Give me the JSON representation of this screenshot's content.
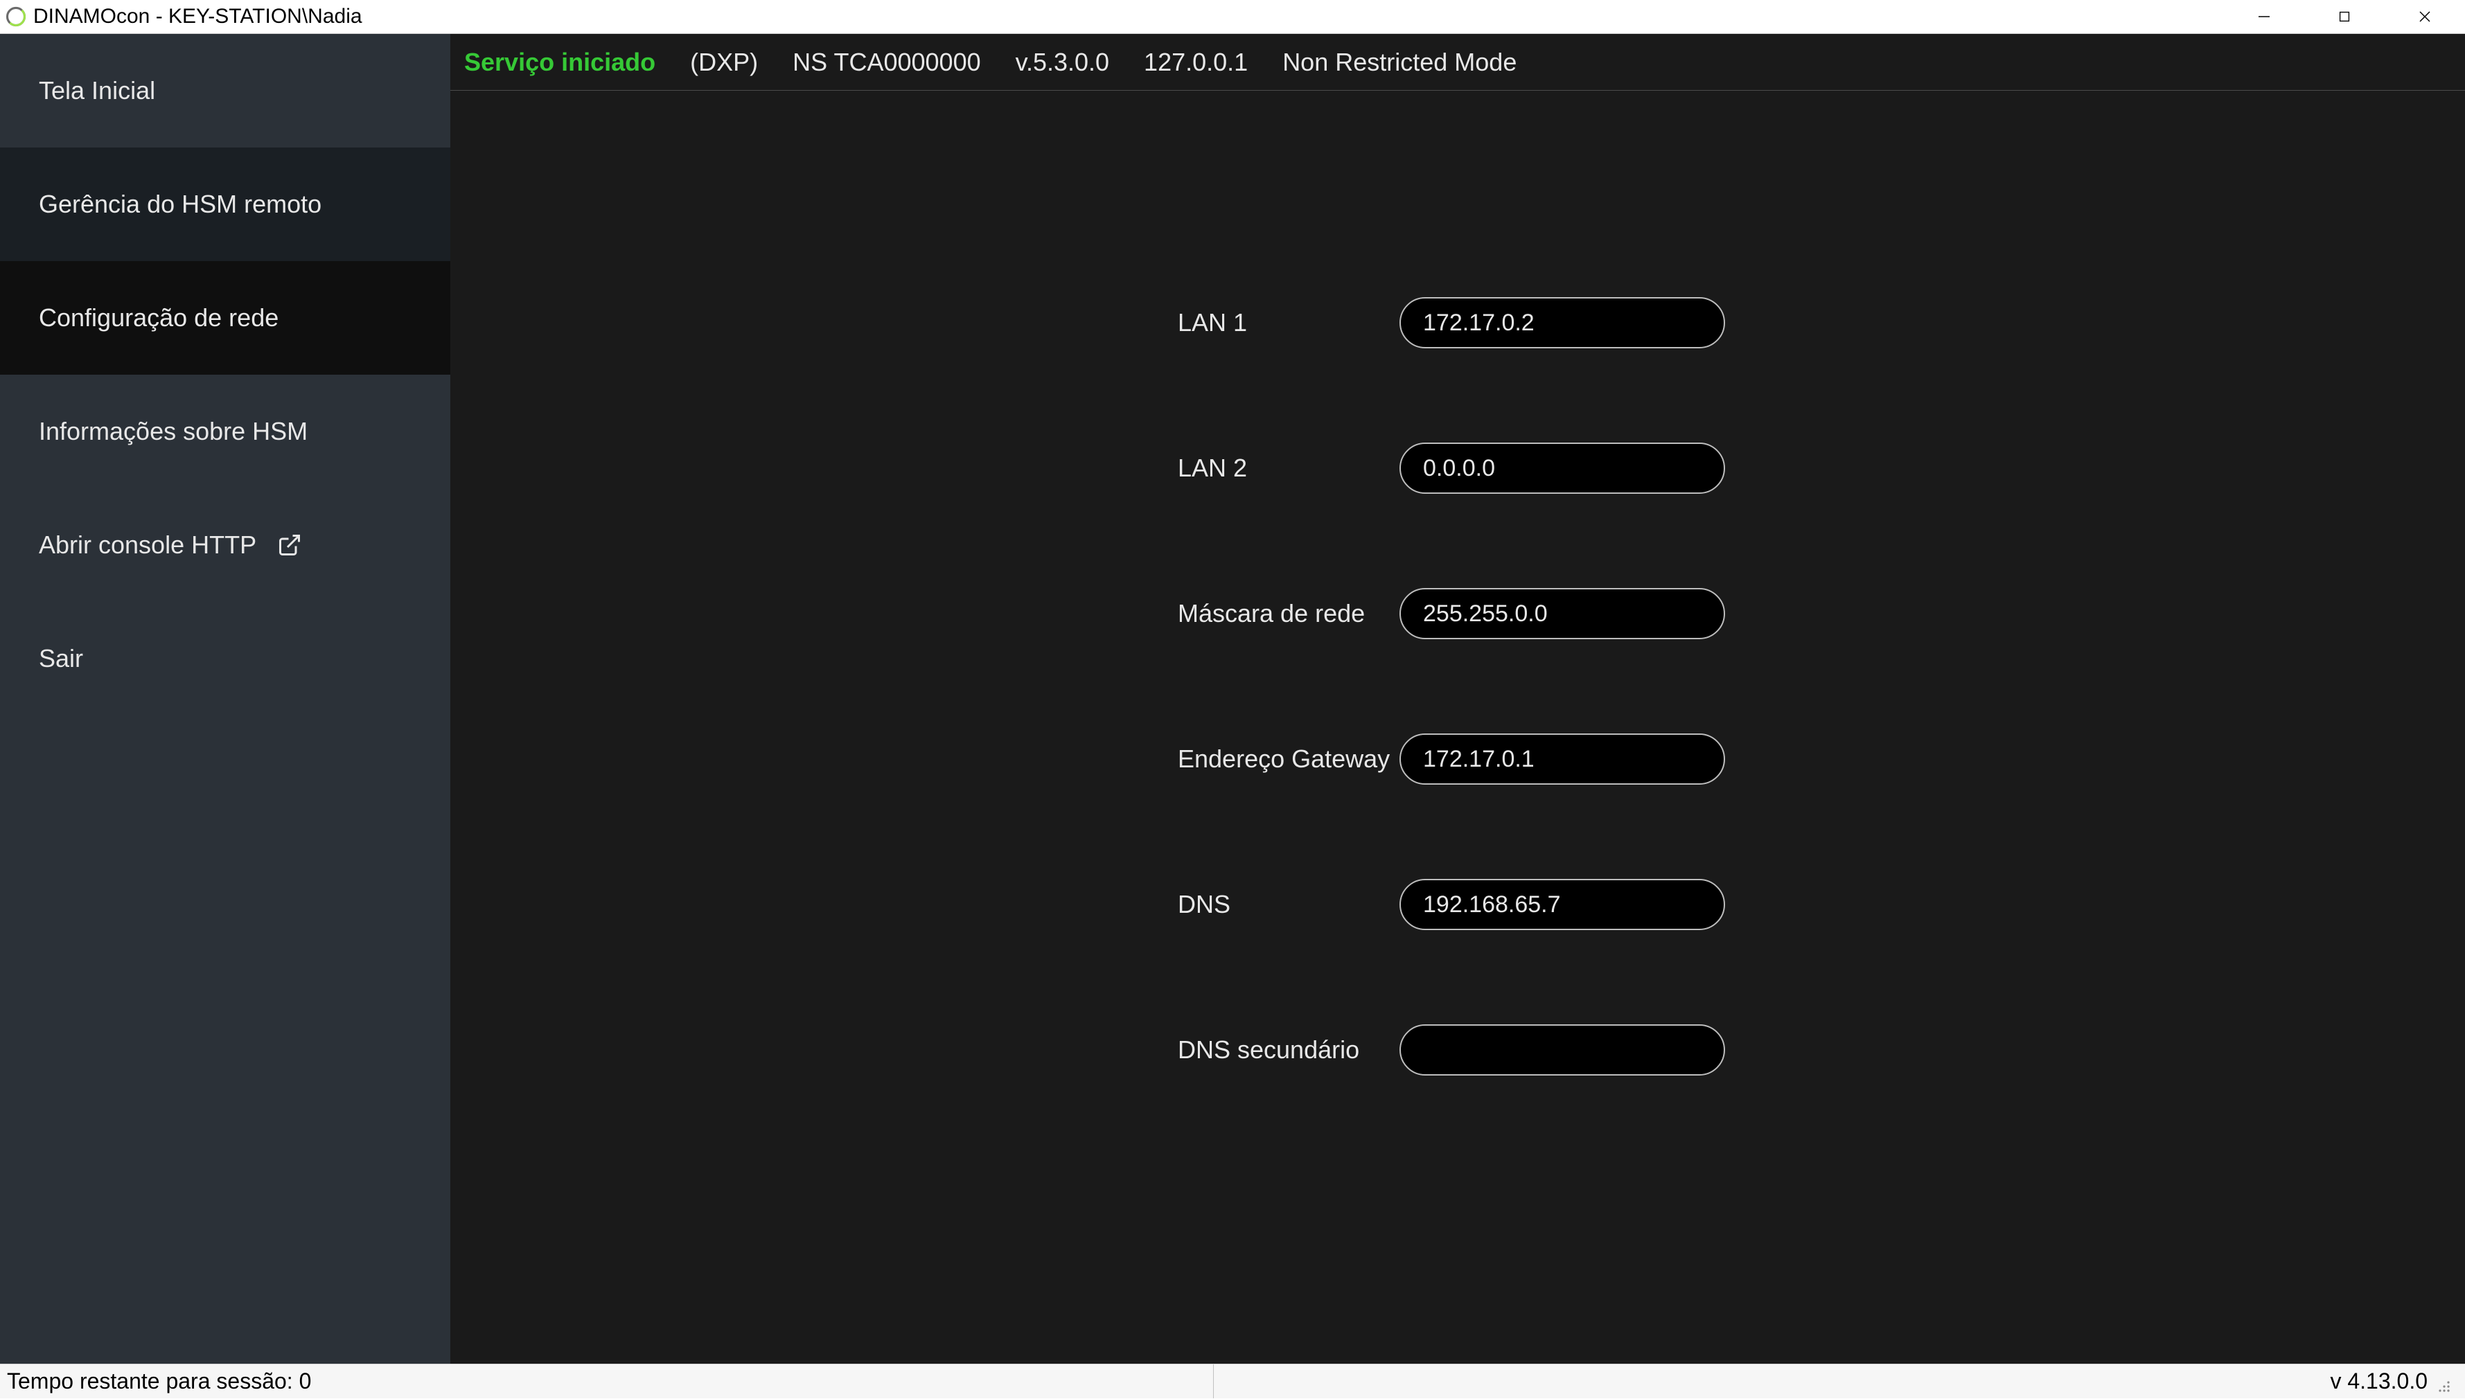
{
  "window": {
    "title": "DINAMOcon - KEY-STATION\\Nadia"
  },
  "status": {
    "state": "Serviço iniciado",
    "model": "(DXP)",
    "serial": "NS TCA0000000",
    "version": "v.5.3.0.0",
    "ip": "127.0.0.1",
    "mode": "Non Restricted Mode"
  },
  "sidebar": {
    "items": [
      {
        "label": "Tela Inicial"
      },
      {
        "label": "Gerência do HSM remoto"
      },
      {
        "label": "Configuração de rede"
      },
      {
        "label": "Informações sobre HSM"
      },
      {
        "label": "Abrir console HTTP"
      },
      {
        "label": "Sair"
      }
    ]
  },
  "form": {
    "lan1": {
      "label": "LAN 1",
      "value": "172.17.0.2"
    },
    "lan2": {
      "label": "LAN 2",
      "value": "0.0.0.0"
    },
    "mask": {
      "label": "Máscara de rede",
      "value": "255.255.0.0"
    },
    "gateway": {
      "label": "Endereço Gateway",
      "value": "172.17.0.1"
    },
    "dns": {
      "label": "DNS",
      "value": "192.168.65.7"
    },
    "dns2": {
      "label": "DNS secundário",
      "value": ""
    }
  },
  "footer": {
    "session_label": "Tempo restante para sessão:",
    "session_value": "0",
    "version": "v 4.13.0.0"
  }
}
